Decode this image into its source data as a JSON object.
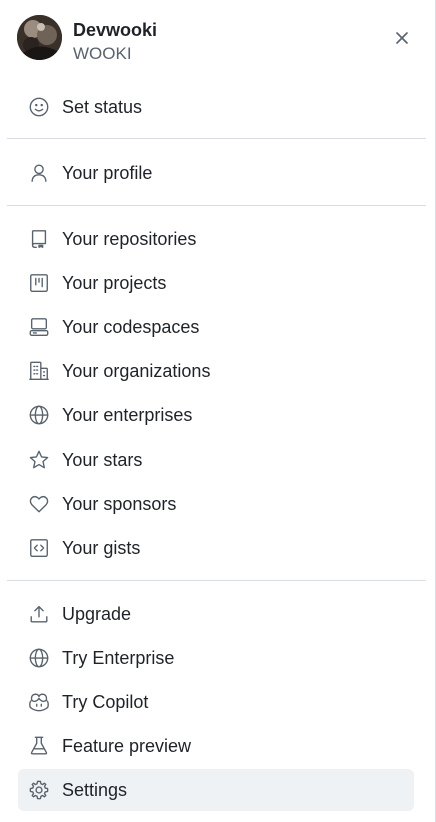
{
  "user": {
    "display_name": "Devwooki",
    "login": "WOOKI"
  },
  "header": {
    "close_icon": "x-icon"
  },
  "menu": {
    "group1": [
      {
        "label": "Set status",
        "icon": "smiley-icon"
      }
    ],
    "group2": [
      {
        "label": "Your profile",
        "icon": "person-icon"
      }
    ],
    "group3": [
      {
        "label": "Your repositories",
        "icon": "repo-icon"
      },
      {
        "label": "Your projects",
        "icon": "table-icon"
      },
      {
        "label": "Your codespaces",
        "icon": "codespaces-icon"
      },
      {
        "label": "Your organizations",
        "icon": "organization-icon"
      },
      {
        "label": "Your enterprises",
        "icon": "globe-icon"
      },
      {
        "label": "Your stars",
        "icon": "star-icon"
      },
      {
        "label": "Your sponsors",
        "icon": "heart-icon"
      },
      {
        "label": "Your gists",
        "icon": "code-square-icon"
      }
    ],
    "group4": [
      {
        "label": "Upgrade",
        "icon": "upload-icon"
      },
      {
        "label": "Try Enterprise",
        "icon": "globe-icon"
      },
      {
        "label": "Try Copilot",
        "icon": "copilot-icon"
      },
      {
        "label": "Feature preview",
        "icon": "beaker-icon"
      },
      {
        "label": "Settings",
        "icon": "gear-icon",
        "active": true
      }
    ]
  },
  "colors": {
    "icon": "#59636e",
    "text": "#1f2328",
    "muted": "#59636e",
    "divider": "#d8dee4",
    "active_bg": "#eff2f5"
  }
}
